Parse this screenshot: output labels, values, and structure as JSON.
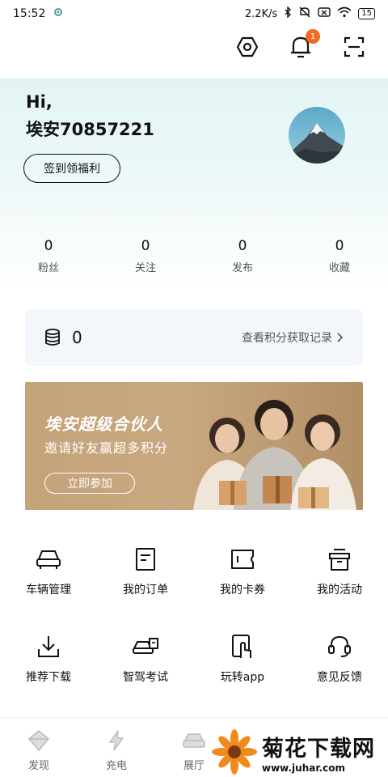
{
  "status_bar": {
    "time": "15:52",
    "net_speed": "2.2K/s",
    "battery": "15"
  },
  "header": {
    "notification_count": "1"
  },
  "profile": {
    "greeting": "Hi,",
    "username": "埃安70857221",
    "sign_in_label": "签到领福利"
  },
  "stats": [
    {
      "value": "0",
      "label": "粉丝"
    },
    {
      "value": "0",
      "label": "关注"
    },
    {
      "value": "0",
      "label": "发布"
    },
    {
      "value": "0",
      "label": "收藏"
    }
  ],
  "points": {
    "value": "0",
    "link_label": "查看积分获取记录"
  },
  "banner": {
    "title": "埃安超级合伙人",
    "subtitle": "邀请好友赢超多积分",
    "button_label": "立即参加"
  },
  "grid_row1": [
    {
      "label": "车辆管理",
      "icon": "car-icon"
    },
    {
      "label": "我的订单",
      "icon": "order-icon"
    },
    {
      "label": "我的卡券",
      "icon": "coupon-icon"
    },
    {
      "label": "我的活动",
      "icon": "gift-icon"
    }
  ],
  "grid_row2": [
    {
      "label": "推荐下载",
      "icon": "download-icon"
    },
    {
      "label": "智驾考试",
      "icon": "smart-drive-icon"
    },
    {
      "label": "玩转app",
      "icon": "touch-app-icon"
    },
    {
      "label": "意见反馈",
      "icon": "headset-icon"
    }
  ],
  "tabbar": [
    {
      "label": "发现"
    },
    {
      "label": "充电"
    },
    {
      "label": "展厅"
    }
  ],
  "watermark": {
    "title": "菊花下载网",
    "url": "www.juhar.com"
  }
}
